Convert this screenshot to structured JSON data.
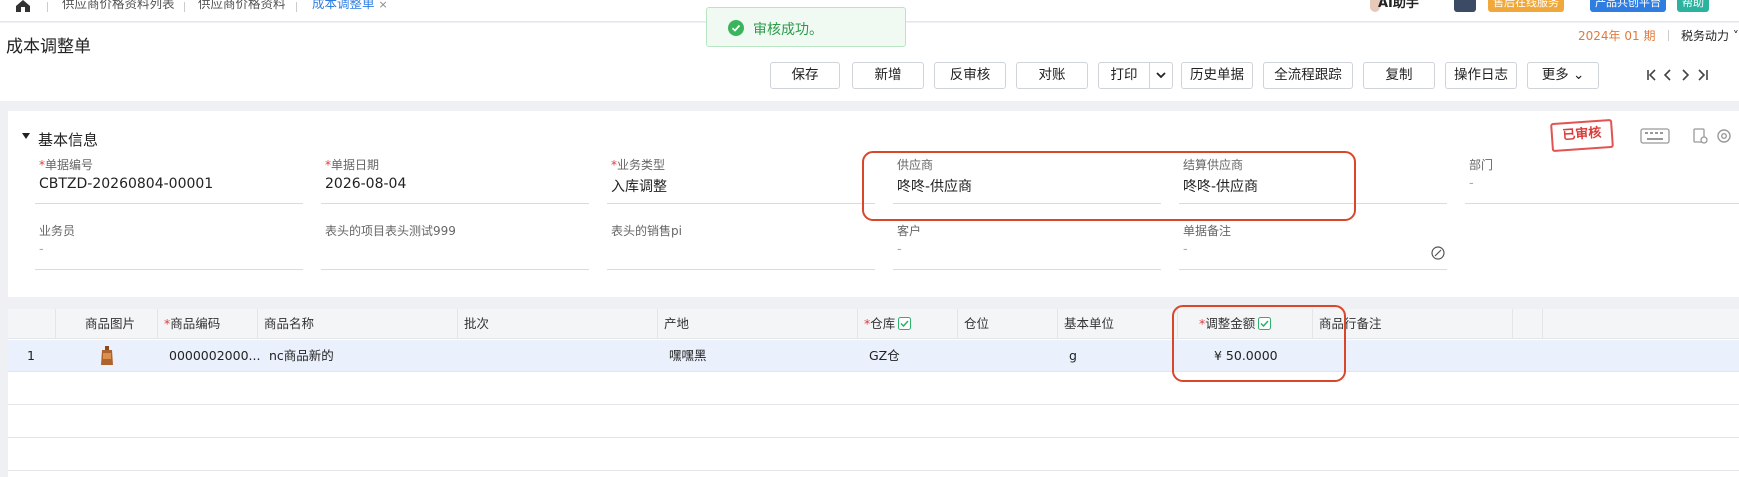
{
  "tabs": [
    {
      "label": "供应商价格资料列表"
    },
    {
      "label": "供应商价格资料"
    },
    {
      "label": "成本调整单",
      "close": "×"
    }
  ],
  "topbar": {
    "ai_assistant": "AI助手",
    "aftersales_btn": "售后在线服务",
    "product_btn": "产品共创平台",
    "help_btn": "帮助"
  },
  "page": {
    "title": "成本调整单",
    "period": "2024年 01 期",
    "org": "税务动力"
  },
  "toolbar": {
    "save": "保存",
    "add": "新增",
    "unaudit": "反审核",
    "reconcile": "对账",
    "print": "打印",
    "history": "历史单据",
    "trace": "全流程跟踪",
    "copy": "复制",
    "log": "操作日志",
    "more": "更多"
  },
  "toast": {
    "text": "审核成功。"
  },
  "basic_info": {
    "title": "基本信息",
    "stamp": "已审核",
    "empty": "-",
    "fields": [
      {
        "label": "单据编号",
        "required": true,
        "value": "CBTZD-20260804-00001"
      },
      {
        "label": "单据日期",
        "required": true,
        "value": "2026-08-04"
      },
      {
        "label": "业务类型",
        "required": true,
        "value": "入库调整"
      },
      {
        "label": "供应商",
        "required": false,
        "value": "咚咚-供应商"
      },
      {
        "label": "结算供应商",
        "required": false,
        "value": "咚咚-供应商"
      },
      {
        "label": "部门",
        "required": false,
        "value": "-"
      },
      {
        "label": "业务员",
        "required": false,
        "value": "-"
      },
      {
        "label": "表头的项目表头测试999",
        "required": false,
        "value": ""
      },
      {
        "label": "表头的销售pi",
        "required": false,
        "value": ""
      },
      {
        "label": "客户",
        "required": false,
        "value": "-"
      },
      {
        "label": "单据备注",
        "required": false,
        "value": "-"
      }
    ]
  },
  "table": {
    "required_mark": "*",
    "columns": {
      "image": "商品图片",
      "code": "商品编码",
      "name": "商品名称",
      "batch": "批次",
      "origin": "产地",
      "warehouse": "仓库",
      "location": "仓位",
      "unit": "基本单位",
      "amount": "调整金额",
      "remark": "商品行备注"
    },
    "rows": [
      {
        "index": "1",
        "code": "0000002000...",
        "name": "nc商品新的",
        "batch": "",
        "origin": "嘿嘿黑",
        "warehouse": "GZ仓",
        "location": "",
        "unit": "g",
        "amount": "¥ 50.0000",
        "remark": ""
      }
    ]
  },
  "colors": {
    "accent": "#2f7de1",
    "success": "#2c9b4b",
    "annotation": "#d9472b",
    "stamp": "#d83d3a",
    "period": "#e07a3a"
  }
}
